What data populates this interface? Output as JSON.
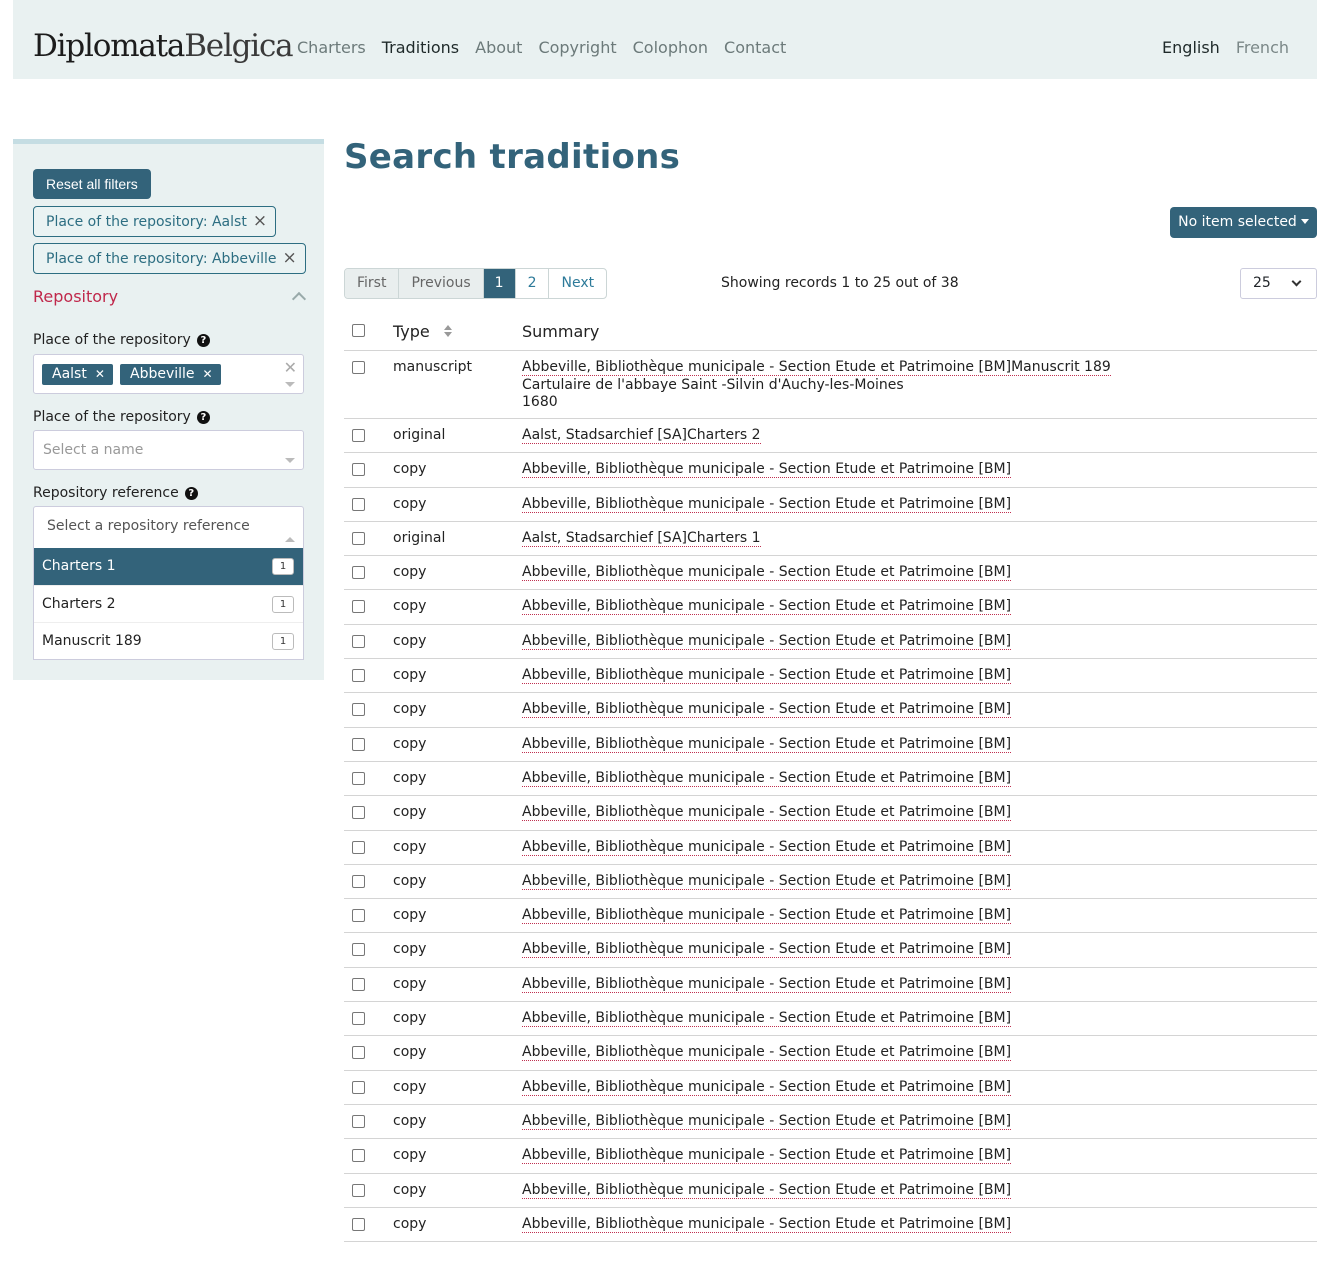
{
  "header": {
    "brand_part1": "Diplomata",
    "brand_part2": "Belgica",
    "nav": [
      "Charters",
      "Traditions",
      "About",
      "Copyright",
      "Colophon",
      "Contact"
    ],
    "active_nav": "Traditions",
    "lang_en": "English",
    "lang_fr": "French"
  },
  "sidebar": {
    "reset_label": "Reset all filters",
    "active_filters": [
      "Place of the repository: Aalst",
      "Place of the repository: Abbeville"
    ],
    "section_title": "Repository",
    "place_label_1": "Place of the repository",
    "place_tags": [
      "Aalst",
      "Abbeville"
    ],
    "place_label_2": "Place of the repository",
    "place_placeholder": "Select a name",
    "ref_label": "Repository reference",
    "ref_placeholder": "Select a repository reference",
    "ref_options": [
      {
        "label": "Charters 1",
        "count": "1"
      },
      {
        "label": "Charters 2",
        "count": "1"
      },
      {
        "label": "Manuscrit 189",
        "count": "1"
      }
    ]
  },
  "main": {
    "title": "Search traditions",
    "selection_button": "No item selected",
    "pager": {
      "first": "First",
      "previous": "Previous",
      "current": "1",
      "page2": "2",
      "next": "Next"
    },
    "showing": "Showing records 1 to 25 out of 38",
    "per_page": "25",
    "columns": {
      "type": "Type",
      "summary": "Summary"
    },
    "rows": [
      {
        "type": "manuscript",
        "summary": [
          "Abbeville, Bibliothèque municipale - Section Etude et Patrimoine [BM]Manuscrit 189",
          "Cartulaire de l'abbaye Saint -Silvin d'Auchy-les-Moines",
          "1680"
        ]
      },
      {
        "type": "original",
        "summary": [
          "Aalst, Stadsarchief [SA]Charters 2"
        ]
      },
      {
        "type": "copy",
        "summary": [
          "Abbeville, Bibliothèque municipale - Section Etude et Patrimoine [BM]"
        ]
      },
      {
        "type": "copy",
        "summary": [
          "Abbeville, Bibliothèque municipale - Section Etude et Patrimoine [BM]"
        ]
      },
      {
        "type": "original",
        "summary": [
          "Aalst, Stadsarchief [SA]Charters 1"
        ]
      },
      {
        "type": "copy",
        "summary": [
          "Abbeville, Bibliothèque municipale - Section Etude et Patrimoine [BM]"
        ]
      },
      {
        "type": "copy",
        "summary": [
          "Abbeville, Bibliothèque municipale - Section Etude et Patrimoine [BM]"
        ]
      },
      {
        "type": "copy",
        "summary": [
          "Abbeville, Bibliothèque municipale - Section Etude et Patrimoine [BM]"
        ]
      },
      {
        "type": "copy",
        "summary": [
          "Abbeville, Bibliothèque municipale - Section Etude et Patrimoine [BM]"
        ]
      },
      {
        "type": "copy",
        "summary": [
          "Abbeville, Bibliothèque municipale - Section Etude et Patrimoine [BM]"
        ]
      },
      {
        "type": "copy",
        "summary": [
          "Abbeville, Bibliothèque municipale - Section Etude et Patrimoine [BM]"
        ]
      },
      {
        "type": "copy",
        "summary": [
          "Abbeville, Bibliothèque municipale - Section Etude et Patrimoine [BM]"
        ]
      },
      {
        "type": "copy",
        "summary": [
          "Abbeville, Bibliothèque municipale - Section Etude et Patrimoine [BM]"
        ]
      },
      {
        "type": "copy",
        "summary": [
          "Abbeville, Bibliothèque municipale - Section Etude et Patrimoine [BM]"
        ]
      },
      {
        "type": "copy",
        "summary": [
          "Abbeville, Bibliothèque municipale - Section Etude et Patrimoine [BM]"
        ]
      },
      {
        "type": "copy",
        "summary": [
          "Abbeville, Bibliothèque municipale - Section Etude et Patrimoine [BM]"
        ]
      },
      {
        "type": "copy",
        "summary": [
          "Abbeville, Bibliothèque municipale - Section Etude et Patrimoine [BM]"
        ]
      },
      {
        "type": "copy",
        "summary": [
          "Abbeville, Bibliothèque municipale - Section Etude et Patrimoine [BM]"
        ]
      },
      {
        "type": "copy",
        "summary": [
          "Abbeville, Bibliothèque municipale - Section Etude et Patrimoine [BM]"
        ]
      },
      {
        "type": "copy",
        "summary": [
          "Abbeville, Bibliothèque municipale - Section Etude et Patrimoine [BM]"
        ]
      },
      {
        "type": "copy",
        "summary": [
          "Abbeville, Bibliothèque municipale - Section Etude et Patrimoine [BM]"
        ]
      },
      {
        "type": "copy",
        "summary": [
          "Abbeville, Bibliothèque municipale - Section Etude et Patrimoine [BM]"
        ]
      },
      {
        "type": "copy",
        "summary": [
          "Abbeville, Bibliothèque municipale - Section Etude et Patrimoine [BM]"
        ]
      },
      {
        "type": "copy",
        "summary": [
          "Abbeville, Bibliothèque municipale - Section Etude et Patrimoine [BM]"
        ]
      },
      {
        "type": "copy",
        "summary": [
          "Abbeville, Bibliothèque municipale - Section Etude et Patrimoine [BM]"
        ]
      }
    ]
  },
  "colors": {
    "primary": "#33637a",
    "header_bg": "#e9f1f1",
    "accent_red": "#c0284b",
    "link": "#2d7a99"
  },
  "icons": [
    "help-icon",
    "close-icon",
    "sort-icon",
    "chevron-down-icon",
    "chevron-up-icon"
  ]
}
